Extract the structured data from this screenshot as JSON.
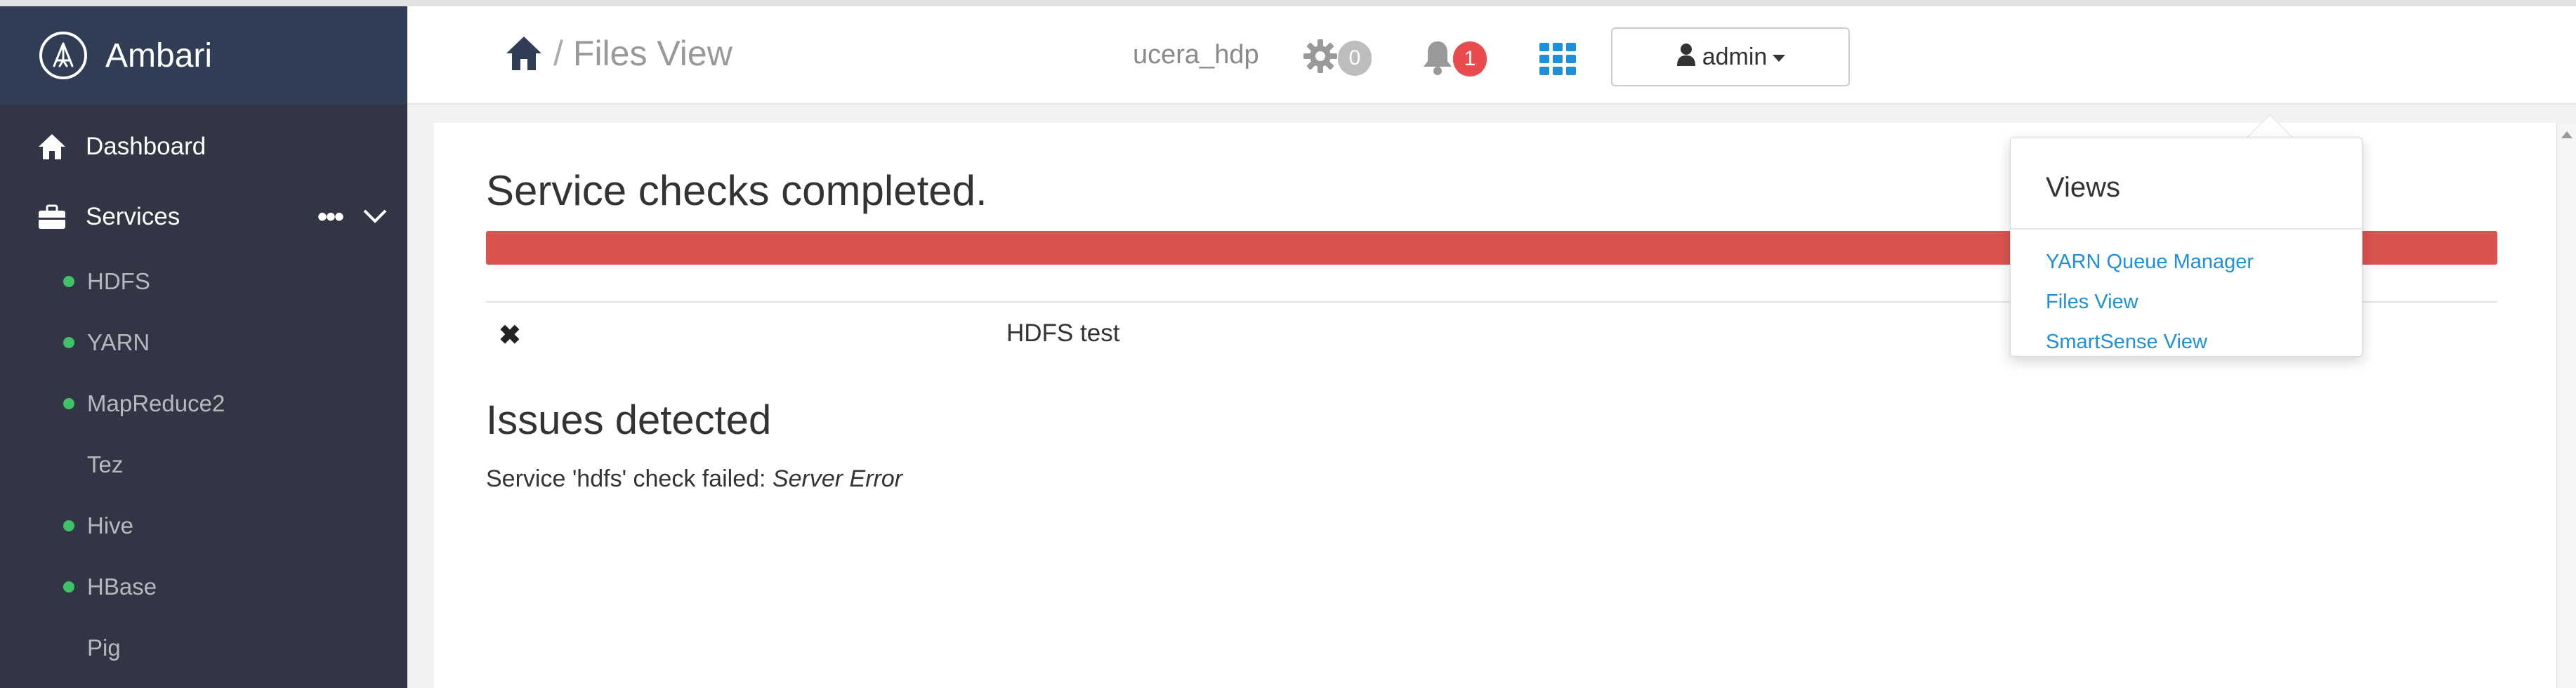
{
  "app": {
    "name": "Ambari"
  },
  "sidebar": {
    "dashboard_label": "Dashboard",
    "services_label": "Services",
    "more_label": "•••",
    "services": [
      {
        "label": "HDFS",
        "status": "started"
      },
      {
        "label": "YARN",
        "status": "started"
      },
      {
        "label": "MapReduce2",
        "status": "started"
      },
      {
        "label": "Tez",
        "status": "client"
      },
      {
        "label": "Hive",
        "status": "started"
      },
      {
        "label": "HBase",
        "status": "started"
      },
      {
        "label": "Pig",
        "status": "client"
      }
    ]
  },
  "header": {
    "breadcrumb_sep": "/",
    "page_title": "Files View",
    "cluster_name": "ucera_hdp",
    "ops_count": "0",
    "alerts_count": "1",
    "user_label": "admin"
  },
  "main": {
    "title": "Service checks completed.",
    "progress_percent": 100,
    "progress_color": "#d9534f",
    "checks": [
      {
        "status_icon": "✖",
        "name": "HDFS test"
      }
    ],
    "issues_title": "Issues detected",
    "issue_prefix": "Service 'hdfs' check failed: ",
    "issue_error": "Server Error"
  },
  "views_menu": {
    "title": "Views",
    "items": [
      {
        "label": "YARN Queue Manager"
      },
      {
        "label": "Files View"
      },
      {
        "label": "SmartSense View"
      }
    ]
  },
  "colors": {
    "sidebar_bg": "#323544",
    "sidebar_head_bg": "#313d54",
    "link": "#1f8fd9",
    "status_green": "#3fc168",
    "alert_red": "#e94c4c"
  }
}
